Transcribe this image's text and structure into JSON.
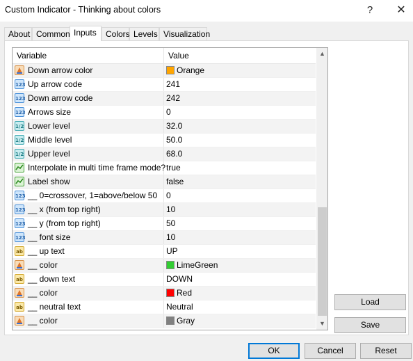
{
  "window": {
    "title": "Custom Indicator - Thinking about colors",
    "help_glyph": "?",
    "close_glyph": "✕"
  },
  "tabs": [
    {
      "label": "About"
    },
    {
      "label": "Common"
    },
    {
      "label": "Inputs"
    },
    {
      "label": "Colors"
    },
    {
      "label": "Levels"
    },
    {
      "label": "Visualization"
    }
  ],
  "grid": {
    "header": {
      "variable": "Variable",
      "value": "Value"
    },
    "rows": [
      {
        "type": "color",
        "icon": "color-param-icon",
        "variable": "Down arrow color",
        "value": "Orange",
        "swatch": "#ffa500"
      },
      {
        "type": "int",
        "icon": "integer-param-icon",
        "variable": "Up arrow code",
        "value": "241"
      },
      {
        "type": "int",
        "icon": "integer-param-icon",
        "variable": "Down arrow code",
        "value": "242"
      },
      {
        "type": "int",
        "icon": "integer-param-icon",
        "variable": "Arrows size",
        "value": "0"
      },
      {
        "type": "double",
        "icon": "double-param-icon",
        "variable": "Lower level",
        "value": "32.0"
      },
      {
        "type": "double",
        "icon": "double-param-icon",
        "variable": "Middle level",
        "value": "50.0"
      },
      {
        "type": "double",
        "icon": "double-param-icon",
        "variable": "Upper level",
        "value": "68.0"
      },
      {
        "type": "bool",
        "icon": "boolean-param-icon",
        "variable": "Interpolate in multi time frame mode?",
        "value": "true"
      },
      {
        "type": "bool",
        "icon": "boolean-param-icon",
        "variable": "Label show",
        "value": "false"
      },
      {
        "type": "int",
        "icon": "integer-param-icon",
        "variable": "__ 0=crossover, 1=above/below 50",
        "value": "0"
      },
      {
        "type": "int",
        "icon": "integer-param-icon",
        "variable": "__ x (from top right)",
        "value": "10"
      },
      {
        "type": "int",
        "icon": "integer-param-icon",
        "variable": "__ y (from top right)",
        "value": "50"
      },
      {
        "type": "int",
        "icon": "integer-param-icon",
        "variable": "__ font size",
        "value": "10"
      },
      {
        "type": "string",
        "icon": "string-param-icon",
        "variable": "__ up text",
        "value": "UP"
      },
      {
        "type": "color",
        "icon": "color-param-icon",
        "variable": "__ color",
        "value": "LimeGreen",
        "swatch": "#32cd32"
      },
      {
        "type": "string",
        "icon": "string-param-icon",
        "variable": "__ down text",
        "value": "DOWN"
      },
      {
        "type": "color",
        "icon": "color-param-icon",
        "variable": "__ color",
        "value": "Red",
        "swatch": "#ff0000"
      },
      {
        "type": "string",
        "icon": "string-param-icon",
        "variable": "__ neutral text",
        "value": "Neutral"
      },
      {
        "type": "color",
        "icon": "color-param-icon",
        "variable": "__ color",
        "value": "Gray",
        "swatch": "#808080"
      }
    ]
  },
  "scrollbar": {
    "up_glyph": "▲",
    "down_glyph": "▼"
  },
  "side_buttons": {
    "load": "Load",
    "save": "Save"
  },
  "footer": {
    "ok": "OK",
    "cancel": "Cancel",
    "reset": "Reset"
  },
  "icon_glyphs": {
    "int": "123",
    "double": "1/2",
    "string": "ab",
    "bool": "",
    "color": ""
  },
  "colors": {
    "accent": "#0078d7"
  }
}
